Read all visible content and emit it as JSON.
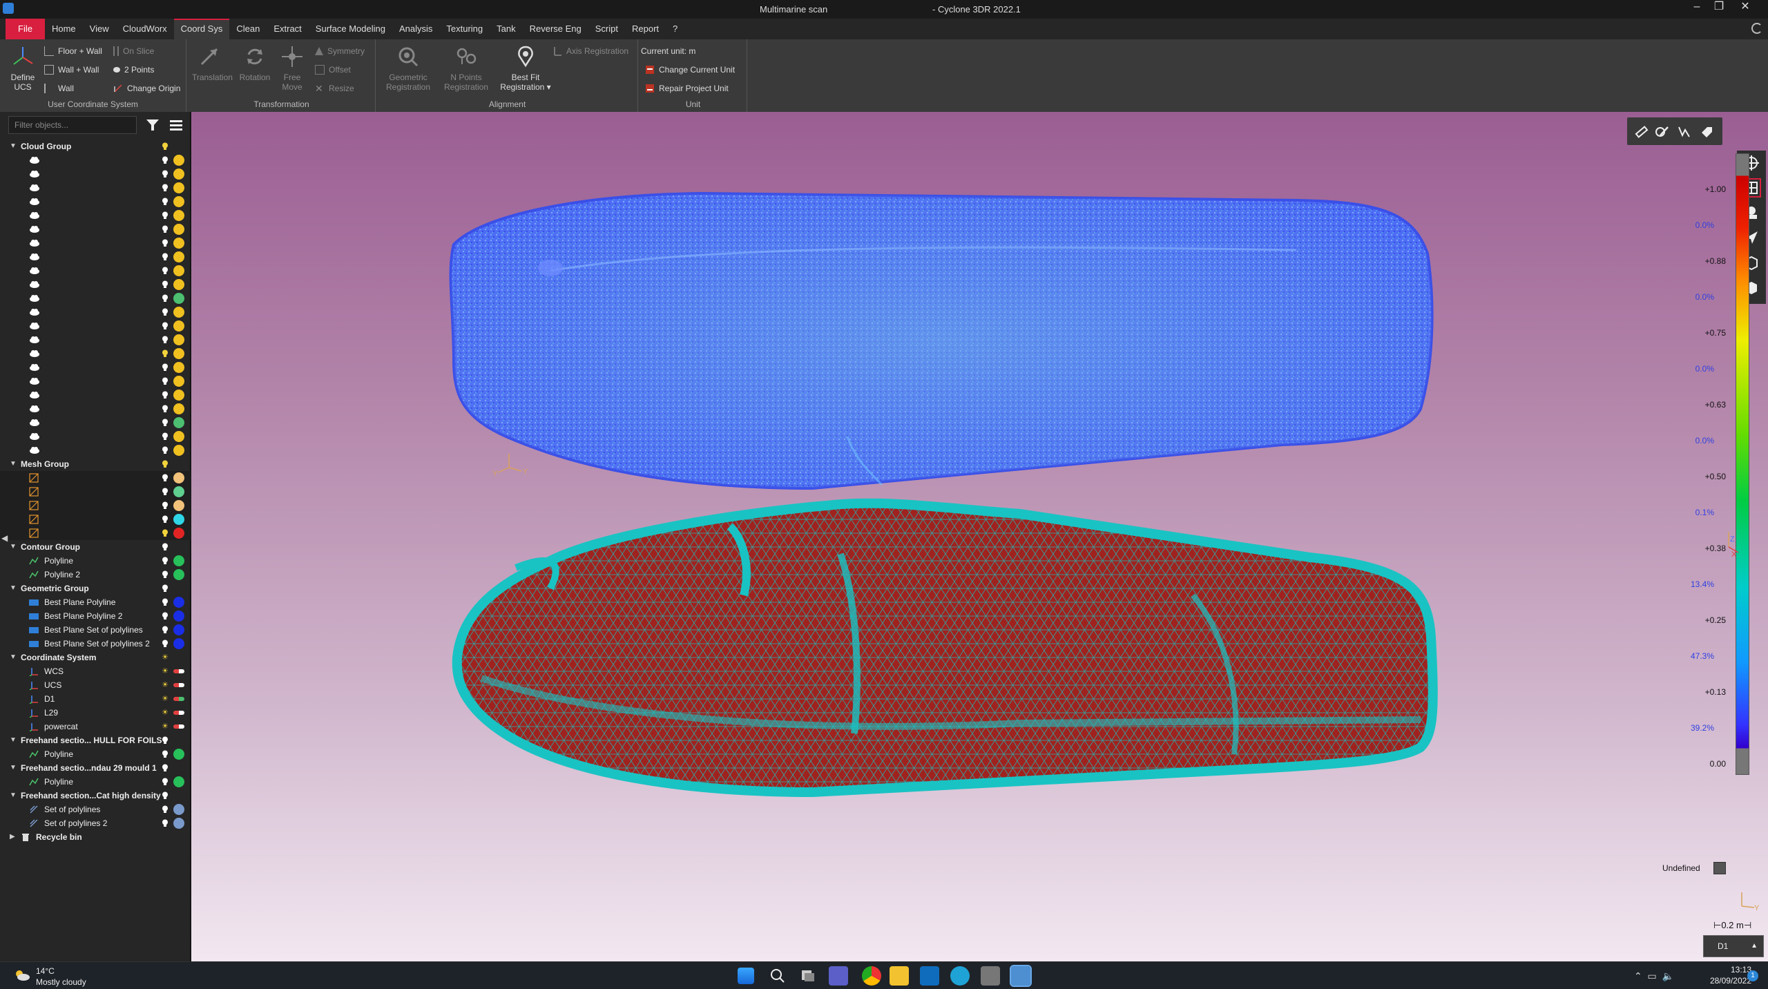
{
  "window": {
    "title_left": "Multimarine scan",
    "title_right": "- Cyclone 3DR 2022.1",
    "minimize": "–",
    "restore": "❐",
    "close": "✕"
  },
  "menu": [
    "File",
    "Home",
    "View",
    "CloudWorx",
    "Coord Sys",
    "Clean",
    "Extract",
    "Surface Modeling",
    "Analysis",
    "Texturing",
    "Tank",
    "Reverse Eng",
    "Script",
    "Report",
    "?"
  ],
  "menu_active": "Coord Sys",
  "ribbon": {
    "ucs": {
      "define_line1": "Define",
      "define_line2": "UCS",
      "floor_wall": "Floor + Wall",
      "wall_wall": "Wall + Wall",
      "wall": "Wall",
      "on_slice": "On Slice",
      "two_points": "2 Points",
      "change_origin": "Change Origin",
      "label": "User Coordinate System"
    },
    "transformation": {
      "translation": "Translation",
      "rotation": "Rotation",
      "free_line1": "Free",
      "free_line2": "Move",
      "symmetry": "Symmetry",
      "offset": "Offset",
      "resize": "Resize",
      "label": "Transformation"
    },
    "alignment": {
      "geo_line1": "Geometric",
      "geo_line2": "Registration",
      "npts_line1": "N Points",
      "npts_line2": "Registration",
      "best_line1": "Best Fit",
      "best_line2": "Registration ▾",
      "axis_reg": "Axis Registration",
      "label": "Alignment"
    },
    "unit": {
      "current": "Current unit: m",
      "change": "Change Current Unit",
      "repair": "Repair Project Unit",
      "label": "Unit"
    }
  },
  "panel": {
    "filter_placeholder": "Filter objects..."
  },
  "tree": {
    "cloud_group": {
      "label": "Cloud Group",
      "items": [
        {
          "color": "#f0c020"
        },
        {
          "color": "#f0c020"
        },
        {
          "color": "#f0c020"
        },
        {
          "color": "#f0c020"
        },
        {
          "color": "#f0c020"
        },
        {
          "color": "#f0c020"
        },
        {
          "color": "#f0c020"
        },
        {
          "color": "#f0c020"
        },
        {
          "color": "#f0c020"
        },
        {
          "color": "#f0c020"
        },
        {
          "color": "#4cc070"
        },
        {
          "color": "#f0c020"
        },
        {
          "color": "#f0c020"
        },
        {
          "color": "#f0c020"
        },
        {
          "color": "#f0c020"
        },
        {
          "color": "#f0c020"
        },
        {
          "color": "#f0c020"
        },
        {
          "color": "#f0c020"
        },
        {
          "color": "#f0c020"
        },
        {
          "color": "#4cc070"
        },
        {
          "color": "#f0c020"
        },
        {
          "color": "#f0c020"
        }
      ]
    },
    "mesh_group": {
      "label": "Mesh Group",
      "items": [
        {
          "color": "#f2c27a"
        },
        {
          "color": "#5fcf8f"
        },
        {
          "color": "#f2c27a"
        },
        {
          "color": "#2fd6e6"
        },
        {
          "color": "#e02424"
        }
      ]
    },
    "contour_group": {
      "label": "Contour Group",
      "items": [
        {
          "label": "Polyline",
          "color": "#27c05a"
        },
        {
          "label": "Polyline 2",
          "color": "#27c05a"
        }
      ]
    },
    "geometric_group": {
      "label": "Geometric Group",
      "items": [
        {
          "label": "Best Plane Polyline",
          "color": "#1a2ee6"
        },
        {
          "label": "Best Plane Polyline 2",
          "color": "#1a2ee6"
        },
        {
          "label": "Best Plane Set of polylines",
          "color": "#1a2ee6"
        },
        {
          "label": "Best Plane Set of polylines 2",
          "color": "#1a2ee6"
        }
      ]
    },
    "coord_system": {
      "label": "Coordinate System",
      "items": [
        {
          "label": "WCS"
        },
        {
          "label": "UCS"
        },
        {
          "label": "D1"
        },
        {
          "label": "L29"
        },
        {
          "label": "powercat"
        }
      ]
    },
    "freehand1": {
      "label": "Freehand sectio... HULL FOR FOILS",
      "item": "Polyline",
      "color": "#27c05a"
    },
    "freehand2": {
      "label": "Freehand sectio...ndau 29 mould 1",
      "item": "Polyline",
      "color": "#27c05a"
    },
    "freehand3": {
      "label": "Freehand section...Cat high density",
      "items": [
        {
          "label": "Set of polylines",
          "color": "#7a9acc"
        },
        {
          "label": "Set of polylines 2",
          "color": "#7a9acc"
        }
      ]
    },
    "recycle": "Recycle bin"
  },
  "viewport": {
    "colors": {
      "cloud_main": "#4a6cff",
      "mesh_fill": "#a62a24",
      "mesh_wire": "#1ec2c0"
    },
    "scale": {
      "values": [
        "+1.00",
        "0.0%",
        "+0.88",
        "0.0%",
        "+0.75",
        "0.0%",
        "+0.63",
        "0.0%",
        "+0.50",
        "0.1%",
        "+0.38",
        "13.4%",
        "+0.25",
        "47.3%",
        "+0.13",
        "39.2%",
        "0.00"
      ],
      "undefined": "Undefined",
      "scalebar": "⊢0.2 m⊣",
      "view": "D1"
    },
    "axis_labels": {
      "y1": "Y",
      "y2": "Y",
      "z": "Z",
      "x": "X"
    }
  },
  "taskbar": {
    "temp": "14°C",
    "weather": "Mostly cloudy",
    "time": "13:13",
    "date": "28/09/2022",
    "notifications": "1"
  }
}
